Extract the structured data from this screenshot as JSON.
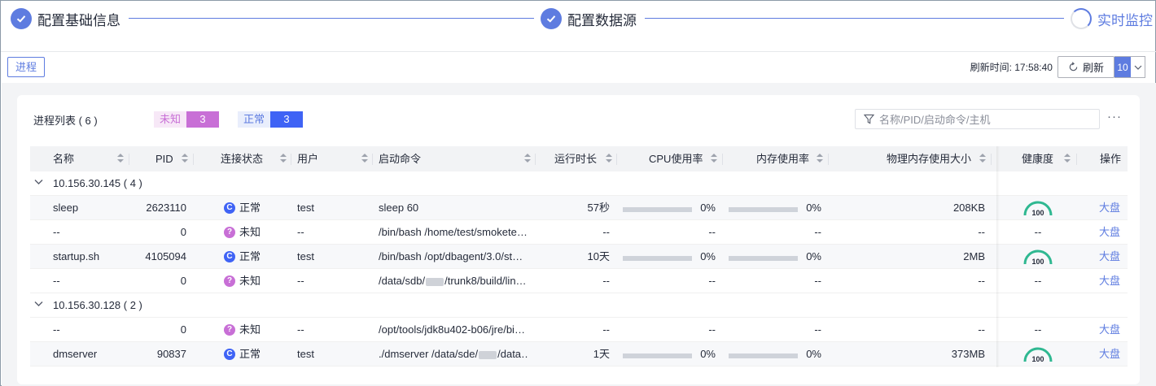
{
  "steps": [
    {
      "label": "配置基础信息",
      "state": "done"
    },
    {
      "label": "配置数据源",
      "state": "done"
    },
    {
      "label": "实时监控",
      "state": "active"
    }
  ],
  "toolbar": {
    "tab_label": "进程",
    "refresh_time_label": "刷新时间: 17:58:40",
    "refresh_button_label": "刷新",
    "interval_value": "10"
  },
  "card": {
    "list_title": "进程列表 ( 6 )",
    "badges": [
      {
        "label": "未知",
        "count": "3",
        "color": "#c86fd6"
      },
      {
        "label": "正常",
        "count": "3",
        "color": "#3f63f5"
      }
    ],
    "search_placeholder": "名称/PID/启动命令/主机",
    "more_label": "···"
  },
  "table": {
    "columns": [
      "名称",
      "PID",
      "连接状态",
      "用户",
      "启动命令",
      "运行时长",
      "CPU使用率",
      "内存使用率",
      "物理内存使用大小",
      "健康度",
      "操作"
    ],
    "groups": [
      {
        "host": "10.156.30.145  ( 4 )",
        "rows": [
          {
            "name": "sleep",
            "pid": "2623110",
            "status": "正常",
            "status_kind": "ok",
            "user": "test",
            "cmd": "sleep 60",
            "cmd_blur": "",
            "uptime": "57秒",
            "cpu": "0%",
            "mem": "0%",
            "phys": "208KB",
            "health": "100",
            "action": "大盘"
          },
          {
            "name": "--",
            "pid": "0",
            "status": "未知",
            "status_kind": "unknown",
            "user": "--",
            "cmd": "/bin/bash /home/test/smokete…",
            "cmd_blur": "",
            "uptime": "--",
            "cpu": "--",
            "mem": "--",
            "phys": "--",
            "health": "--",
            "action": "大盘"
          },
          {
            "name": "startup.sh",
            "pid": "4105094",
            "status": "正常",
            "status_kind": "ok",
            "user": "test",
            "cmd": "/bin/bash /opt/dbagent/3.0/st…",
            "cmd_blur": "",
            "uptime": "10天",
            "cpu": "0%",
            "mem": "0%",
            "phys": "2MB",
            "health": "100",
            "action": "大盘"
          },
          {
            "name": "--",
            "pid": "0",
            "status": "未知",
            "status_kind": "unknown",
            "user": "--",
            "cmd": "/data/sdb/",
            "cmd_blur": "/trunk8/build/lin…",
            "uptime": "--",
            "cpu": "--",
            "mem": "--",
            "phys": "--",
            "health": "--",
            "action": "大盘"
          }
        ]
      },
      {
        "host": "10.156.30.128  ( 2 )",
        "rows": [
          {
            "name": "--",
            "pid": "0",
            "status": "未知",
            "status_kind": "unknown",
            "user": "--",
            "cmd": "/opt/tools/jdk8u402-b06/jre/bi…",
            "cmd_blur": "",
            "uptime": "--",
            "cpu": "--",
            "mem": "--",
            "phys": "--",
            "health": "--",
            "action": "大盘"
          },
          {
            "name": "dmserver",
            "pid": "90837",
            "status": "正常",
            "status_kind": "ok",
            "user": "test",
            "cmd": "./dmserver /data/sde/",
            "cmd_blur": "/data…",
            "uptime": "1天",
            "cpu": "0%",
            "mem": "0%",
            "phys": "373MB",
            "health": "100",
            "action": "大盘"
          }
        ]
      }
    ]
  },
  "colors": {
    "accent": "#5e7ce0",
    "unknown": "#c86fd6",
    "normal": "#3f63f5",
    "gauge": "#2fb891"
  }
}
